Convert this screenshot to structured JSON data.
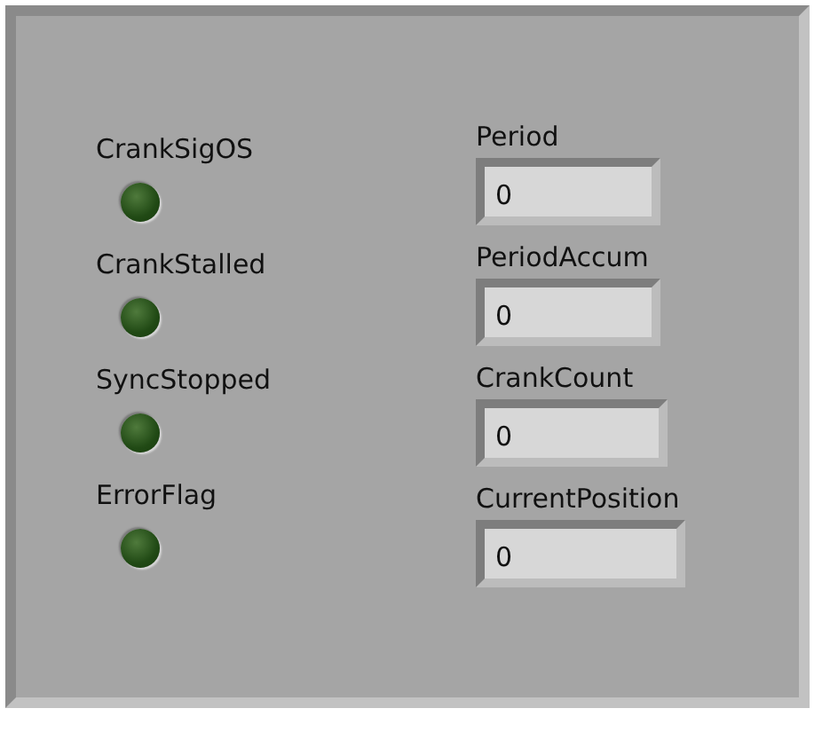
{
  "indicators": [
    {
      "label": "CrankSigOS",
      "on": false
    },
    {
      "label": "CrankStalled",
      "on": false
    },
    {
      "label": "SyncStopped",
      "on": false
    },
    {
      "label": "ErrorFlag",
      "on": false
    }
  ],
  "numerics": [
    {
      "label": "Period",
      "value": "0"
    },
    {
      "label": "PeriodAccum",
      "value": "0"
    },
    {
      "label": "CrankCount",
      "value": "0"
    },
    {
      "label": "CurrentPosition",
      "value": "0"
    }
  ]
}
